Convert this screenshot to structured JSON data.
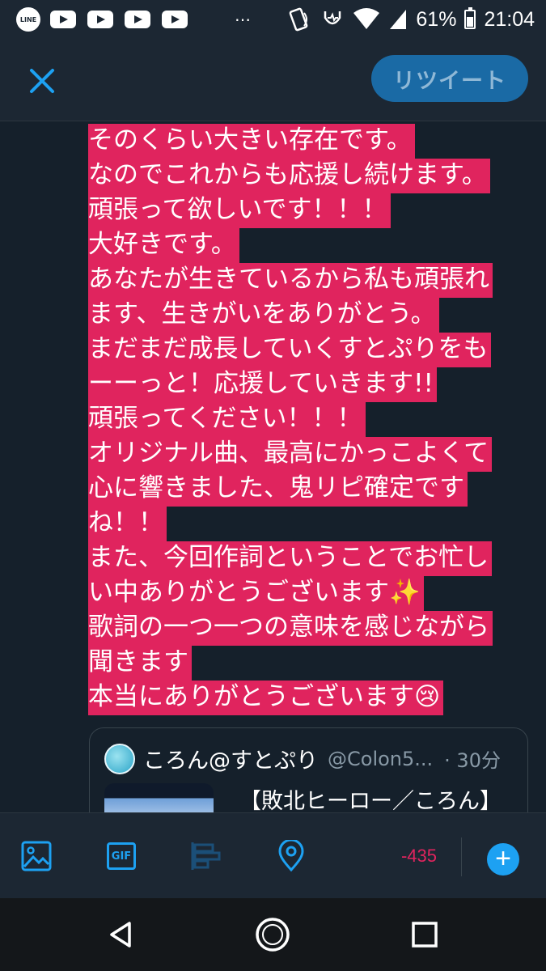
{
  "status_bar": {
    "icons": [
      "line-icon",
      "youtube-icon",
      "youtube-icon",
      "youtube-icon",
      "youtube-icon",
      "more-dots-icon",
      "nfc-icon",
      "heart-rate-icon",
      "wifi-icon",
      "cell-signal-icon",
      "battery-icon"
    ],
    "line_label": "LINE",
    "dots": "…",
    "battery_percent": "61%",
    "battery_level": 0.61,
    "time": "21:04"
  },
  "app_bar": {
    "retweet_label": "リツイート"
  },
  "tweet_text": {
    "lines": [
      "そのくらい大きい存在です。",
      "なのでこれからも応援し続けます。",
      "頑張って欲しいです！！！",
      "大好きです。",
      "あなたが生きているから私も頑張れ",
      "ます、生きがいをありがとう。",
      "まだまだ成長していくすとぷりをも",
      "ーーっと！応援していきます!!",
      "頑張ってください！！！",
      "オリジナル曲、最高にかっこよくて",
      "心に響きました、鬼リピ確定です",
      "ね！！",
      "また、今回作詞ということでお忙し",
      "い中ありがとうございます✨",
      "歌詞の一つ一つの意味を感じながら",
      "聞きます",
      "本当にありがとうございます😢"
    ],
    "highlight_color": "#e0245e"
  },
  "quote": {
    "name": "ころん@すとぷり",
    "handle": "@Colon5...",
    "time": "· 30分",
    "text": "【敗北ヒーロー／ころん】"
  },
  "toolbar": {
    "gif_label": "GIF",
    "counter": "-435",
    "add_label": "+",
    "accent": "#1da1f2",
    "counter_color": "#e0245e"
  },
  "nav_bar": {
    "icons": [
      "back-icon",
      "home-icon",
      "recents-icon"
    ]
  }
}
